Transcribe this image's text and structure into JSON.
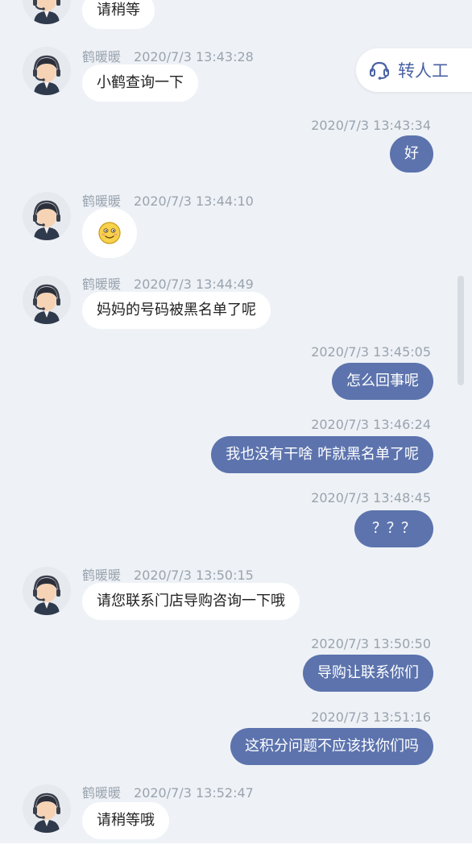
{
  "agent": {
    "name": "鹤暖暖"
  },
  "transfer_button": {
    "label": "转人工",
    "icon": "headset-icon"
  },
  "colors": {
    "outgoing_bubble": "#5c73ad",
    "background": "#eef2f7",
    "accent": "#4a61a3"
  },
  "messages": [
    {
      "dir": "in",
      "text": "请稍等"
    },
    {
      "dir": "in",
      "time": "2020/7/3 13:43:28",
      "text": "小鹤查询一下"
    },
    {
      "dir": "out",
      "time": "2020/7/3 13:43:34",
      "text": "好"
    },
    {
      "dir": "in",
      "time": "2020/7/3 13:44:10",
      "text": "",
      "emoji": "smiling-face-emoji"
    },
    {
      "dir": "in",
      "time": "2020/7/3 13:44:49",
      "text": "妈妈的号码被黑名单了呢"
    },
    {
      "dir": "out",
      "time": "2020/7/3 13:45:05",
      "text": "怎么回事呢"
    },
    {
      "dir": "out",
      "time": "2020/7/3 13:46:24",
      "text": "我也没有干啥 咋就黑名单了呢"
    },
    {
      "dir": "out",
      "time": "2020/7/3 13:48:45",
      "text": "？？？"
    },
    {
      "dir": "in",
      "time": "2020/7/3 13:50:15",
      "text": "请您联系门店导购咨询一下哦"
    },
    {
      "dir": "out",
      "time": "2020/7/3 13:50:50",
      "text": "导购让联系你们"
    },
    {
      "dir": "out",
      "time": "2020/7/3 13:51:16",
      "text": "这积分问题不应该找你们吗"
    },
    {
      "dir": "in",
      "time": "2020/7/3 13:52:47",
      "text": "请稍等哦"
    }
  ]
}
